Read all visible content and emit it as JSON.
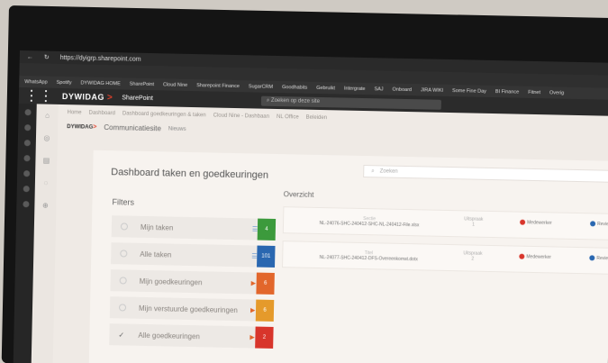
{
  "browser": {
    "address": "https://dyigrp.sharepoint.com",
    "bookmarks": [
      "WhatsApp",
      "Spotify",
      "DYWIDAG HOME",
      "SharePoint",
      "Cloud Nine",
      "Sharepoint Finance",
      "SugarCRM",
      "Goodhabits",
      "Gebruikt",
      "Intergrate",
      "SAJ",
      "Onboard",
      "JIRA WIKI",
      "Some Fine Day",
      "BI Finance",
      "Fitnet",
      "Overig"
    ]
  },
  "sharepoint": {
    "brand": "DYWIDAG",
    "app_name": "SharePoint",
    "search_placeholder": "Zoeken op deze site"
  },
  "breadcrumb": [
    "Home",
    "Dashboard",
    "Dashboard goedkeuringen & taken",
    "Cloud Nine - Dashbaan",
    "NL Office",
    "Beleiden"
  ],
  "site": {
    "title": "Communicatiesite",
    "subtitle": "Nieuws"
  },
  "dashboard": {
    "title": "Dashboard taken en goedkeuringen",
    "search_placeholder": "Zoeken",
    "filters_title": "Filters",
    "filters": [
      {
        "label": "Mijn taken",
        "icon": "list-icon",
        "count": "4",
        "color": "#3c9a3c",
        "checked": false
      },
      {
        "label": "Alle taken",
        "icon": "list-icon",
        "count": "101",
        "color": "#2a67b0",
        "checked": false
      },
      {
        "label": "Mijn goedkeuringen",
        "icon": "flag-icon",
        "count": "6",
        "color": "#e2662b",
        "checked": false
      },
      {
        "label": "Mijn verstuurde goedkeuringen",
        "icon": "flag-icon",
        "count": "6",
        "color": "#e59a2b",
        "checked": false
      },
      {
        "label": "Alle goedkeuringen",
        "icon": "flag-icon",
        "count": "2",
        "color": "#d8352b",
        "checked": true
      }
    ],
    "overview_title": "Overzicht",
    "overview_rows": [
      {
        "header": "Sectie",
        "name": "NL-24076-SHC-240412-SHC-NL-240412-File.xlsx",
        "status_header": "Uitspraak",
        "status": "1",
        "owner": "Medewerker",
        "reviewer": "Reviewer"
      },
      {
        "header": "Titel",
        "name": "NL-24077-SHC-240412-DFS-Overeenkomst.dotx",
        "status_header": "Uitspraak",
        "status": "2",
        "owner": "Medewerker",
        "reviewer": "Reviewer"
      }
    ]
  },
  "colors": {
    "accent_red": "#e2402b",
    "suite_bar": "#2b2b2b"
  }
}
